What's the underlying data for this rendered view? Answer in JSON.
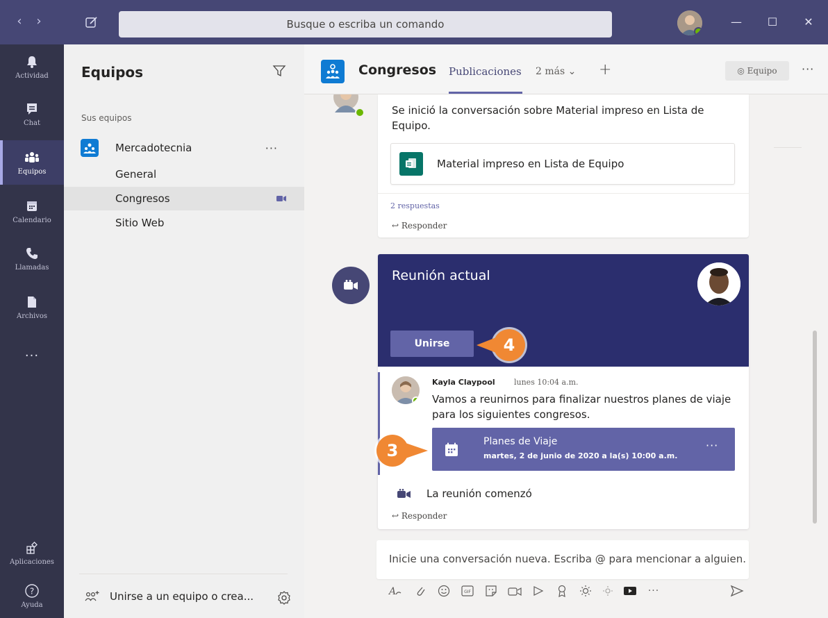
{
  "titlebar": {
    "back": "‹",
    "forward": "›",
    "search_placeholder": "Busque o escriba un comando",
    "minimize": "—",
    "maximize": "☐",
    "close": "✕"
  },
  "rail": {
    "items": [
      {
        "label": "Actividad",
        "icon": "bell-icon"
      },
      {
        "label": "Chat",
        "icon": "chat-icon"
      },
      {
        "label": "Equipos",
        "icon": "teams-icon"
      },
      {
        "label": "Calendario",
        "icon": "calendar-icon"
      },
      {
        "label": "Llamadas",
        "icon": "phone-icon"
      },
      {
        "label": "Archivos",
        "icon": "file-icon"
      }
    ],
    "more": "···",
    "apps_label": "Aplicaciones",
    "help_label": "Ayuda"
  },
  "teams_pane": {
    "title": "Equipos",
    "section_label": "Sus equipos",
    "team_name": "Mercadotecnia",
    "team_more": "···",
    "channels": [
      "General",
      "Congresos",
      "Sitio Web"
    ],
    "join_label": "Unirse a un equipo o crea..."
  },
  "header": {
    "team_title": "Congresos",
    "tab_active": "Publicaciones",
    "tab_more": "2 más ⌄",
    "add_tab": "+",
    "team_button": "◎ Equipo",
    "more": "···"
  },
  "post1": {
    "text": "Se inició la conversación sobre Material impreso en Lista de Equipo.",
    "file_name": "Material impreso en Lista de Equipo",
    "replies": "2 respuestas",
    "reply": "↩ Responder"
  },
  "meeting": {
    "title": "Reunión actual",
    "join_label": "Unirse",
    "callout_join": "4",
    "callout_event": "3",
    "author": "Kayla Claypool",
    "time": "lunes 10:04 a.m.",
    "message": "Vamos a reunirnos para finalizar nuestros planes de viaje para los siguientes congresos.",
    "event_title": "Planes de Viaje",
    "event_date": "martes, 2 de junio de 2020 a la(s) 10:00 a.m.",
    "event_more": "···",
    "started_label": "La reunión comenzó",
    "reply": "↩ Responder"
  },
  "compose": {
    "placeholder": "Inicie una conversación nueva. Escriba @ para mencionar a alguien.",
    "more": "···"
  },
  "colors": {
    "titlebar": "#464775",
    "rail": "#33344a",
    "accent": "#6264a7",
    "meeting_header": "#2b2e6e",
    "callout": "#f08833",
    "status_available": "#6bb700"
  }
}
